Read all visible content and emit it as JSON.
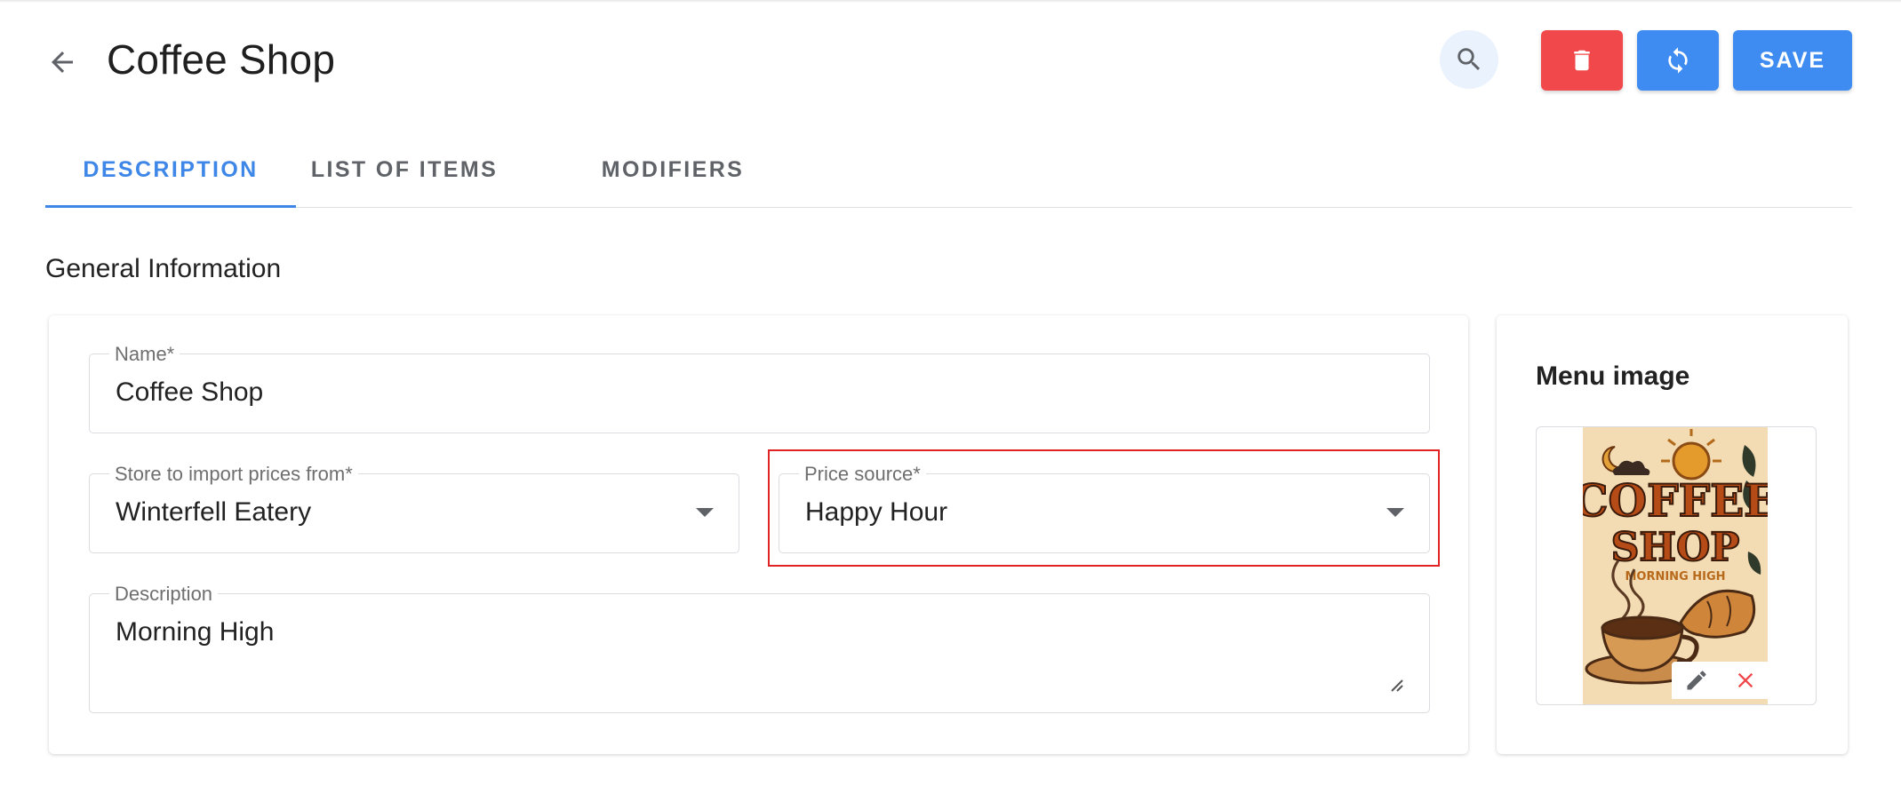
{
  "header": {
    "title": "Coffee Shop",
    "save_label": "SAVE"
  },
  "tabs": [
    {
      "label": "DESCRIPTION",
      "active": true
    },
    {
      "label": "LIST OF ITEMS",
      "active": false
    },
    {
      "label": "MODIFIERS",
      "active": false
    }
  ],
  "section": {
    "title": "General Information"
  },
  "form": {
    "name": {
      "label": "Name*",
      "value": "Coffee Shop"
    },
    "store": {
      "label": "Store to import prices from*",
      "value": "Winterfell Eatery"
    },
    "price_source": {
      "label": "Price source*",
      "value": "Happy Hour"
    },
    "description": {
      "label": "Description",
      "value": "Morning High"
    }
  },
  "menu_image": {
    "title": "Menu image",
    "poster_text": {
      "line1": "COFFEE",
      "line2": "SHOP",
      "line3": "MORNING HIGH"
    }
  },
  "colors": {
    "accent": "#3e87e8",
    "danger": "#f0484b",
    "highlight": "#e02424"
  }
}
